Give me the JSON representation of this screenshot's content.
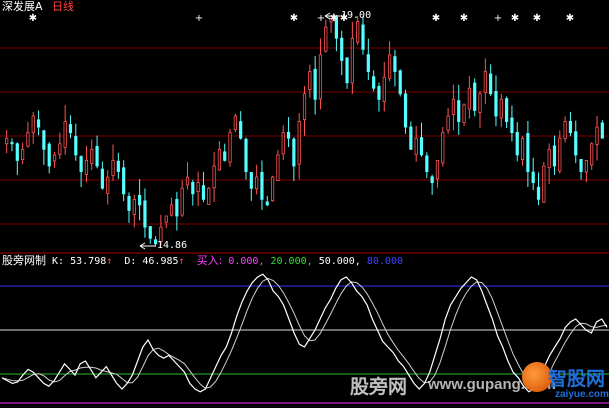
{
  "header": {
    "index_name": "深发展A",
    "period": "日线"
  },
  "price_panel": {
    "high_marker_text": "19.00",
    "low_marker_text": "14.86",
    "prices": [
      16.8,
      16.7,
      16.4,
      16.6,
      16.9,
      17.2,
      17.0,
      16.6,
      16.3,
      16.5,
      16.7,
      17.1,
      16.9,
      16.5,
      16.2,
      16.4,
      16.6,
      16.3,
      15.9,
      16.1,
      16.4,
      16.2,
      15.8,
      15.5,
      15.7,
      15.6,
      15.2,
      15.0,
      14.9,
      15.2,
      15.4,
      15.6,
      15.4,
      15.9,
      16.1,
      15.8,
      16.0,
      15.7,
      15.9,
      16.3,
      16.6,
      16.4,
      16.9,
      17.2,
      16.8,
      16.2,
      15.9,
      16.1,
      15.7,
      15.6,
      16.1,
      16.5,
      16.9,
      16.8,
      16.3,
      17.1,
      17.6,
      18.0,
      17.5,
      18.3,
      18.8,
      19.0,
      18.6,
      18.2,
      17.8,
      18.6,
      18.9,
      18.4,
      18.0,
      17.7,
      17.5,
      17.9,
      18.3,
      18.0,
      17.6,
      17.0,
      16.6,
      16.8,
      16.5,
      16.2,
      16.0,
      16.4,
      16.9,
      17.2,
      17.5,
      17.1,
      17.4,
      17.7,
      17.3,
      17.6,
      18.0,
      17.6,
      17.2,
      17.5,
      17.1,
      16.9,
      16.5,
      16.8,
      16.2,
      16.0,
      15.7,
      16.3,
      16.6,
      16.3,
      16.8,
      17.1,
      16.9,
      16.5,
      16.2,
      16.4,
      16.7,
      17.0,
      16.8
    ]
  },
  "indicator_panel": {
    "name": "股旁网制",
    "k_label": "K:",
    "k_value": "53.798",
    "d_label": "D:",
    "d_value": "46.985",
    "arrow": "↑",
    "buy_label": "买入:",
    "level_0": "0.000,",
    "level_20": "20.000,",
    "level_50": "50.000,",
    "level_80": "80.000",
    "k_series": [
      18,
      16,
      14,
      15,
      20,
      24,
      22,
      18,
      14,
      12,
      16,
      22,
      28,
      24,
      20,
      28,
      30,
      24,
      18,
      22,
      26,
      20,
      14,
      10,
      14,
      20,
      30,
      40,
      45,
      38,
      34,
      32,
      34,
      30,
      26,
      22,
      14,
      10,
      8,
      10,
      18,
      26,
      34,
      40,
      50,
      62,
      72,
      80,
      86,
      90,
      92,
      88,
      80,
      76,
      70,
      60,
      50,
      42,
      40,
      46,
      52,
      60,
      68,
      74,
      82,
      88,
      90,
      86,
      80,
      76,
      70,
      60,
      52,
      44,
      40,
      36,
      30,
      26,
      20,
      14,
      10,
      14,
      22,
      34,
      46,
      60,
      70,
      76,
      82,
      86,
      90,
      88,
      80,
      70,
      60,
      48,
      40,
      30,
      22,
      18,
      12,
      8,
      10,
      18,
      26,
      34,
      40,
      46,
      54,
      58,
      60,
      56,
      52,
      50,
      58,
      60,
      54
    ]
  },
  "watermark": {
    "site_cn": "股旁网",
    "site_url": "www.gupang.com",
    "logo_cn": "智股网",
    "logo_url": "zaiyue.com"
  },
  "colors": {
    "up": "#ff5454",
    "down": "#54ffff",
    "indicator_line": "#ffffff",
    "level_80_line": "#3030ff",
    "level_50_line": "#ffffff",
    "level_20_line": "#30c030",
    "level_0_line": "#ff30ff",
    "grid": "#8b0000"
  }
}
